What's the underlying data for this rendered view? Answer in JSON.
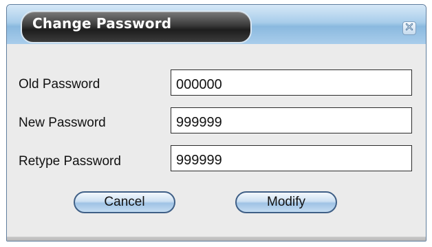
{
  "dialog": {
    "title": "Change Password",
    "close_icon": "close-icon"
  },
  "fields": [
    {
      "label": "Old Password",
      "value": "000000"
    },
    {
      "label": "New Password",
      "value": "999999"
    },
    {
      "label": "Retype Password",
      "value": "999999"
    }
  ],
  "buttons": {
    "cancel_label": "Cancel",
    "modify_label": "Modify"
  },
  "colors": {
    "title_bar": "#a8cdea",
    "title_tab": "#2a2a2a",
    "button_fill": "#cde0f2",
    "button_border": "#3f5f86"
  }
}
